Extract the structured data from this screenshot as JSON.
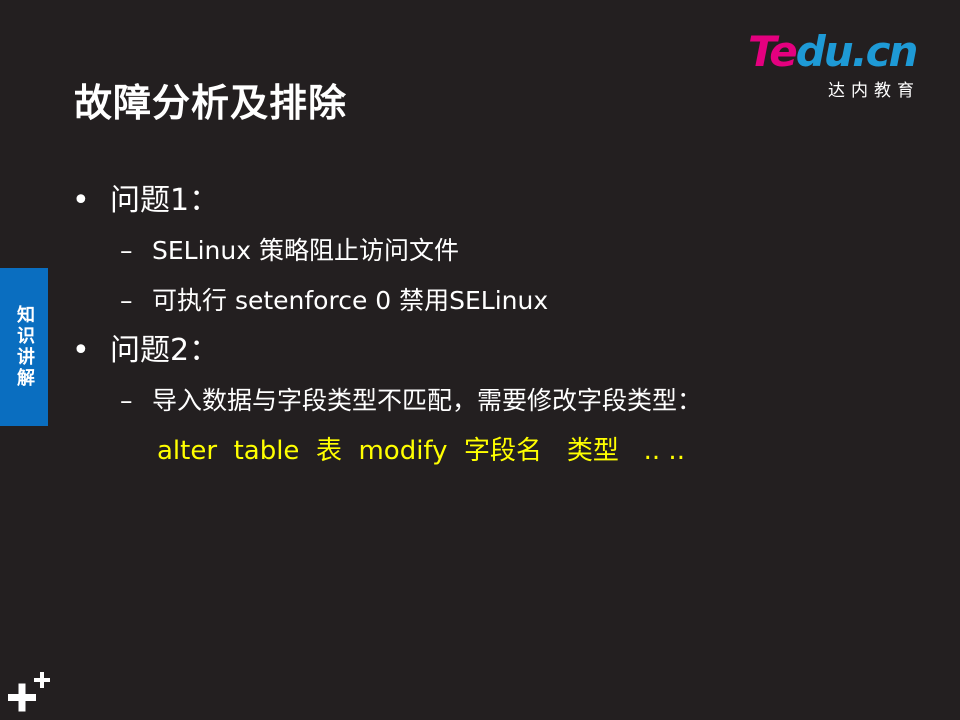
{
  "slide": {
    "title": "故障分析及排除",
    "side_tab": "知识讲解"
  },
  "logo": {
    "word_part1": "Te",
    "word_part2": "du.cn",
    "subtitle": "达内教育"
  },
  "bullets": [
    {
      "text": "问题1：",
      "subs": [
        "SELinux 策略阻止访问文件",
        "可执行 setenforce  0 禁用SELinux"
      ]
    },
    {
      "text": "问题2：",
      "subs": [
        "导入数据与字段类型不匹配，需要修改字段类型："
      ]
    }
  ],
  "code_line": "alter  table  表  modify  字段名   类型   .. ..",
  "colors": {
    "background": "#231f20",
    "accent_blue": "#0a6ec0",
    "code_yellow": "#ffff00",
    "logo_pink": "#e4007f",
    "logo_blue": "#1e9ad6"
  }
}
